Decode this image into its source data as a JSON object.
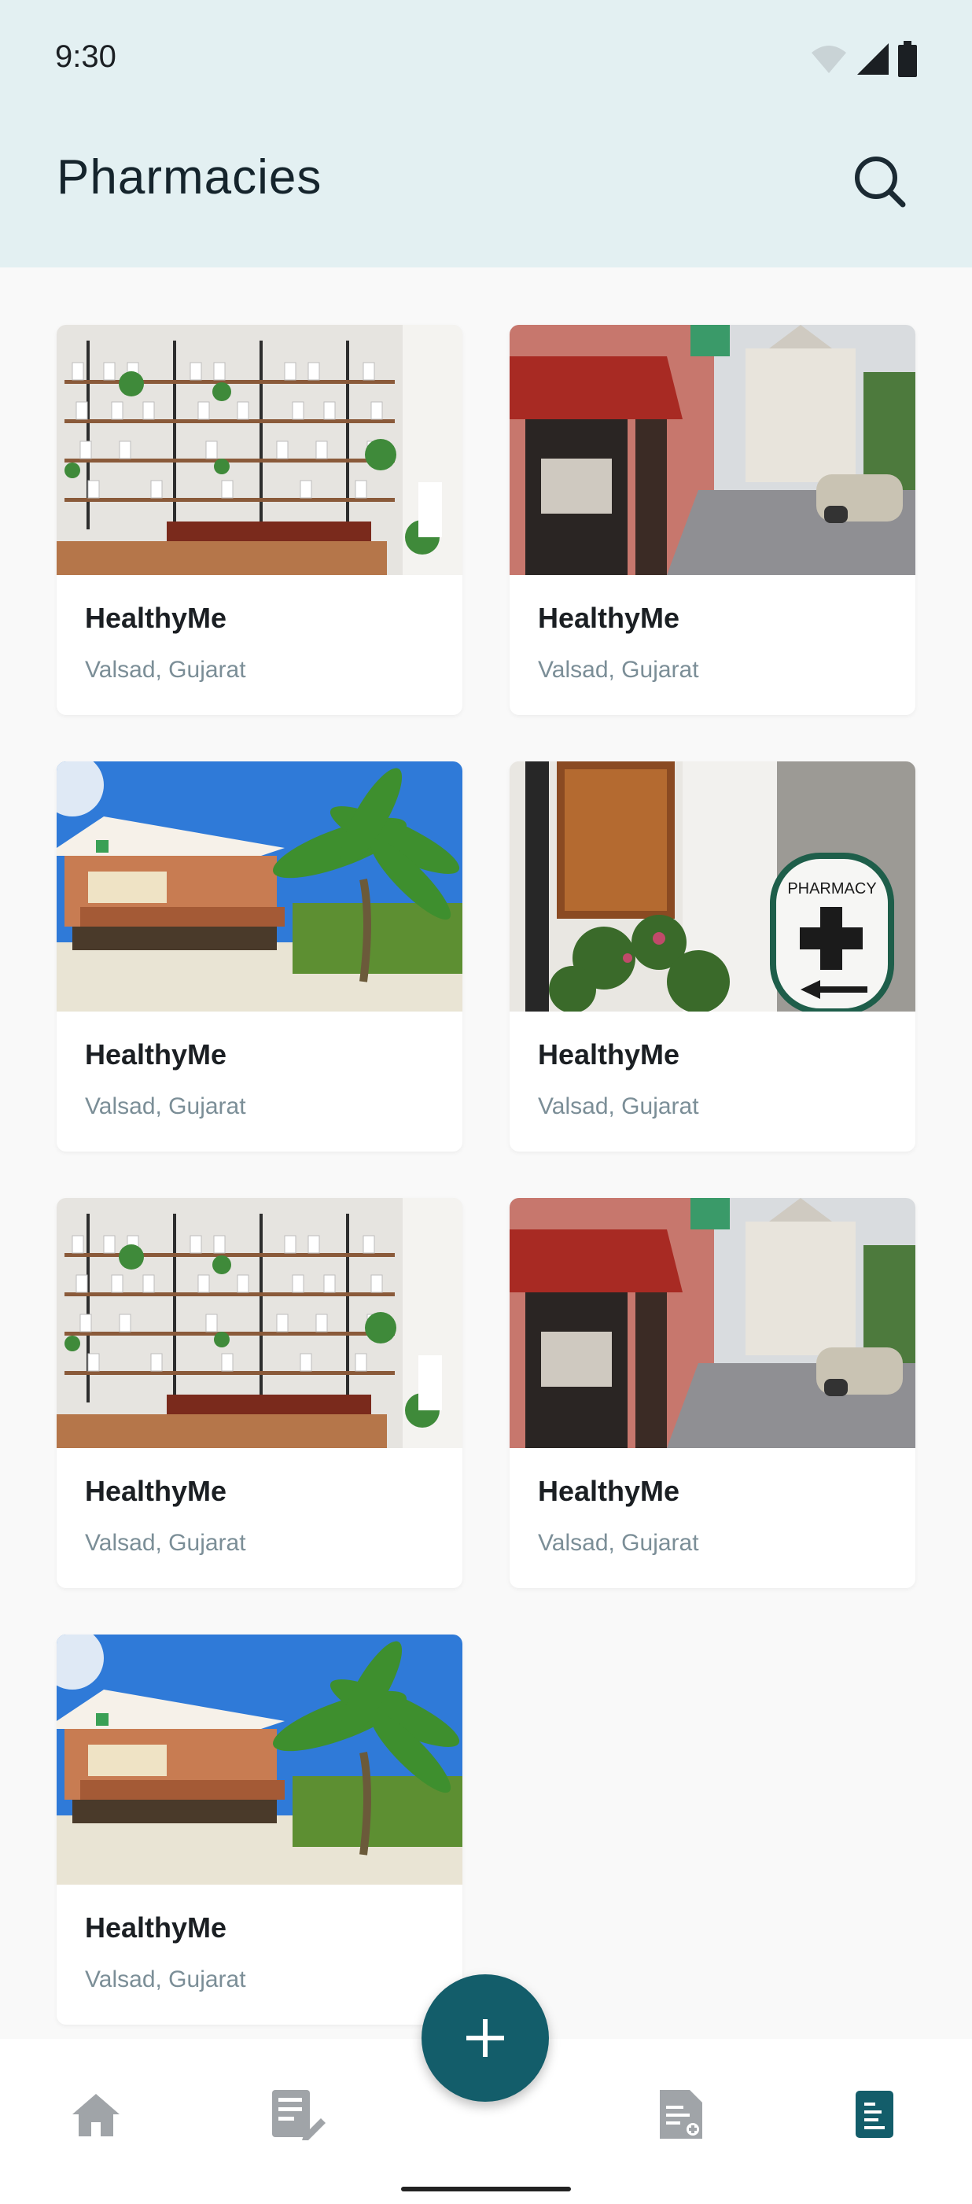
{
  "status_bar": {
    "time": "9:30"
  },
  "header": {
    "title": "Pharmacies"
  },
  "cards": [
    {
      "name": "HealthyMe",
      "location": "Valsad, Gujarat",
      "image": "pharmacy-interior-shelves"
    },
    {
      "name": "HealthyMe",
      "location": "Valsad, Gujarat",
      "image": "pharmacy-street-view"
    },
    {
      "name": "HealthyMe",
      "location": "Valsad, Gujarat",
      "image": "pharmacy-beach-house"
    },
    {
      "name": "HealthyMe",
      "location": "Valsad, Gujarat",
      "image": "pharmacy-sign-storefront"
    },
    {
      "name": "HealthyMe",
      "location": "Valsad, Gujarat",
      "image": "pharmacy-interior-shelves"
    },
    {
      "name": "HealthyMe",
      "location": "Valsad, Gujarat",
      "image": "pharmacy-street-view"
    },
    {
      "name": "HealthyMe",
      "location": "Valsad, Gujarat",
      "image": "pharmacy-beach-house"
    }
  ],
  "nav": {
    "items": [
      "home-icon",
      "prescription-icon",
      "add-icon",
      "document-add-icon",
      "list-document-icon"
    ],
    "active": "list-document-icon"
  },
  "colors": {
    "accent": "#135d6a",
    "header_bg": "#e3f0f2",
    "subtitle": "#7b8e97",
    "nav_inactive": "#a0a4a8"
  }
}
